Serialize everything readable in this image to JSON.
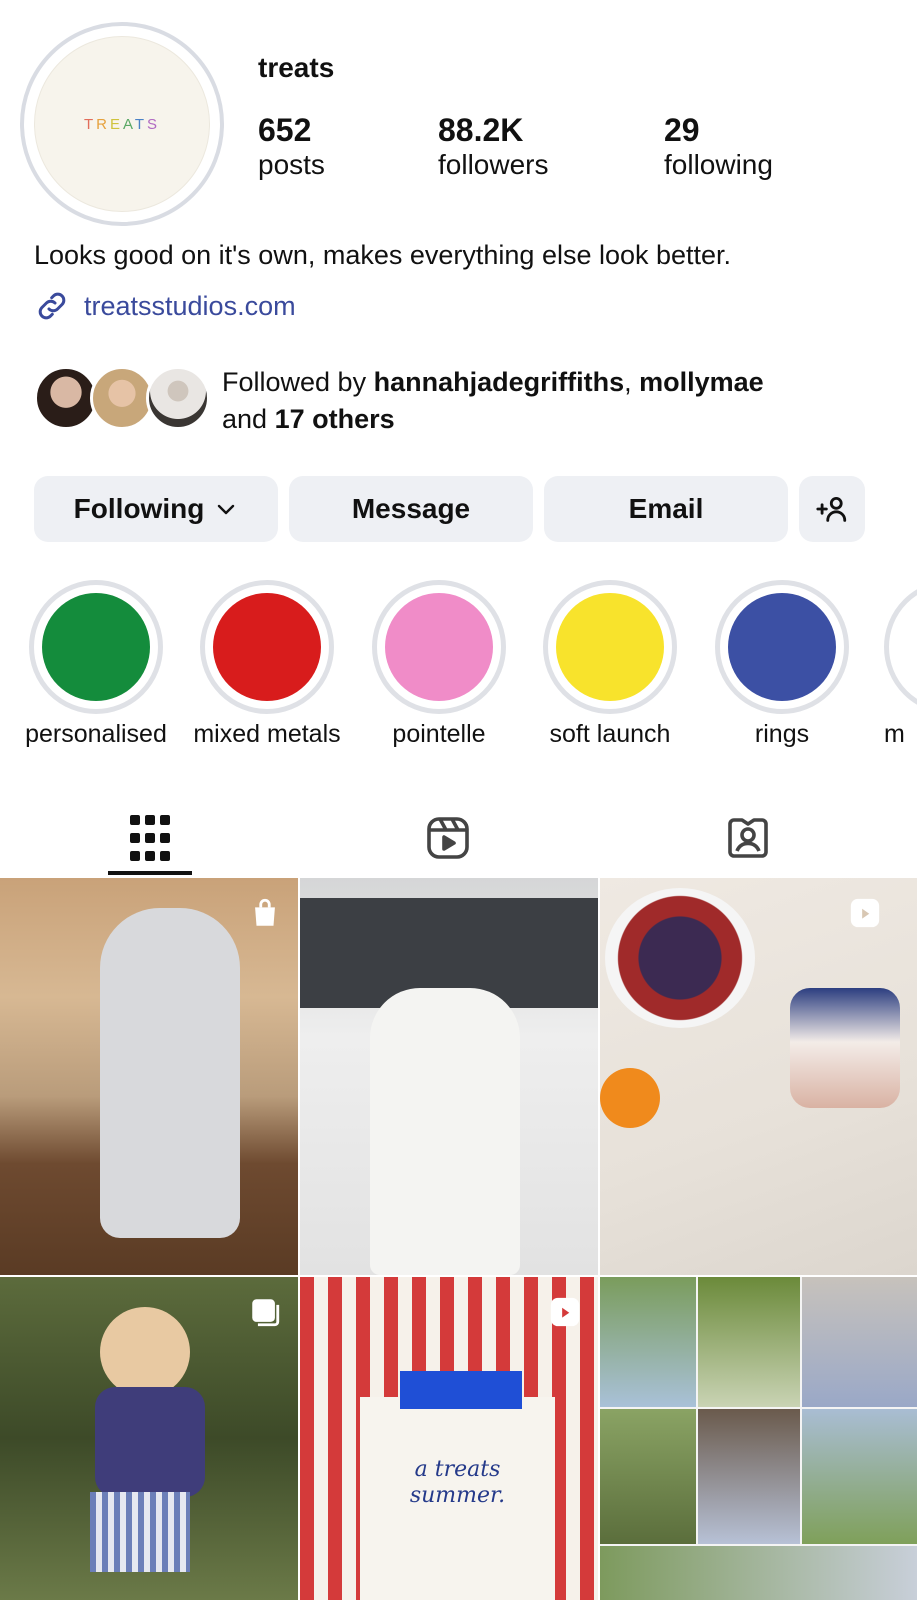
{
  "profile": {
    "logo_text": "TREATS",
    "username": "treats",
    "stats": {
      "posts": {
        "value": "652",
        "label": "posts"
      },
      "followers": {
        "value": "88.2K",
        "label": "followers"
      },
      "following": {
        "value": "29",
        "label": "following"
      }
    },
    "bio": "Looks good on it's own, makes everything else look better.",
    "link": "treatsstudios.com"
  },
  "followed_by": {
    "prefix": "Followed by ",
    "user1": "hannahjadegriffiths",
    "separator": ", ",
    "user2": "mollymae",
    "and": "and ",
    "others": "17 others"
  },
  "actions": {
    "following": "Following",
    "message": "Message",
    "email": "Email"
  },
  "highlights": [
    {
      "label": "personalised",
      "color": "#148c3c"
    },
    {
      "label": "mixed metals",
      "color": "#d81c1c"
    },
    {
      "label": "pointelle",
      "color": "#f08cc8"
    },
    {
      "label": "soft launch",
      "color": "#f8e32c"
    },
    {
      "label": "rings",
      "color": "#3c50a4"
    },
    {
      "label": "m",
      "color": "#ffffff"
    }
  ],
  "grid_caption": {
    "line1": "a treats",
    "line2": "summer."
  },
  "colors": {
    "link": "#3a4a9c",
    "button_bg": "#eef0f4"
  }
}
